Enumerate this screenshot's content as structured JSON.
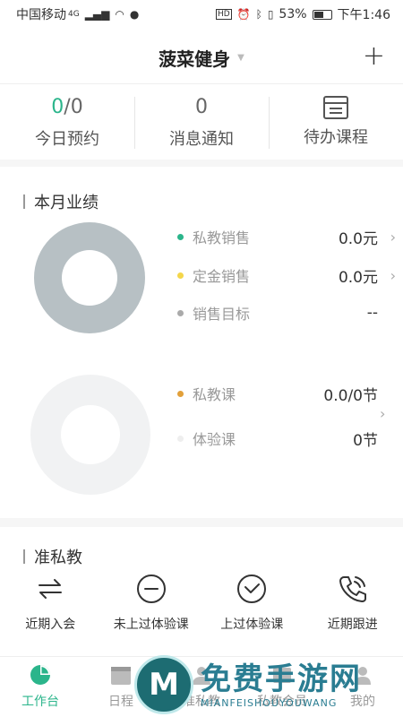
{
  "status_bar": {
    "carrier": "中国移动",
    "network": "4G",
    "battery": "53%",
    "time": "下午1:46"
  },
  "header": {
    "title": "菠菜健身",
    "add_icon": "plus-icon"
  },
  "stats": [
    {
      "value_highlight": "0",
      "value_rest": "/0",
      "label": "今日预约"
    },
    {
      "value": "0",
      "label": "消息通知"
    },
    {
      "label": "待办课程",
      "icon": "calendar-list-icon"
    }
  ],
  "performance": {
    "title": "本月业绩",
    "sales_donut_color": "#b7c0c4",
    "lessons_donut_color": "#f1f2f3",
    "sales_rows": [
      {
        "label": "私教销售",
        "value": "0.0元",
        "dot_color": "#2bb58b",
        "arrow": true
      },
      {
        "label": "定金销售",
        "value": "0.0元",
        "dot_color": "#f4d64a",
        "arrow": true
      },
      {
        "label": "销售目标",
        "value": "--",
        "dot_color": "#aaaaaa",
        "arrow": false
      }
    ],
    "lesson_rows": [
      {
        "label": "私教课",
        "value": "0.0/0节",
        "dot_color": "#e2a03a"
      },
      {
        "label": "体验课",
        "value": "0节",
        "dot_color": "#eeeeee"
      }
    ]
  },
  "prospects": {
    "title": "准私教",
    "items": [
      {
        "label": "近期入会",
        "icon": "swap-arrows-icon"
      },
      {
        "label": "未上过体验课",
        "icon": "minus-circle-icon"
      },
      {
        "label": "上过体验课",
        "icon": "check-circle-icon"
      },
      {
        "label": "近期跟进",
        "icon": "phone-icon"
      }
    ]
  },
  "tabbar": {
    "items": [
      {
        "label": "工作台",
        "icon": "pie-chart-icon",
        "active": true
      },
      {
        "label": "日程",
        "icon": "calendar-icon",
        "active": false
      },
      {
        "label": "准私教",
        "icon": "users-icon",
        "active": false
      },
      {
        "label": "私教会员",
        "icon": "member-icon",
        "active": false
      },
      {
        "label": "我的",
        "icon": "person-icon",
        "active": false
      }
    ]
  },
  "watermark": {
    "title": "免费手游网",
    "subtitle": "MIANFEISHOUYOUWANG"
  },
  "colors": {
    "accent": "#2bb58b"
  }
}
